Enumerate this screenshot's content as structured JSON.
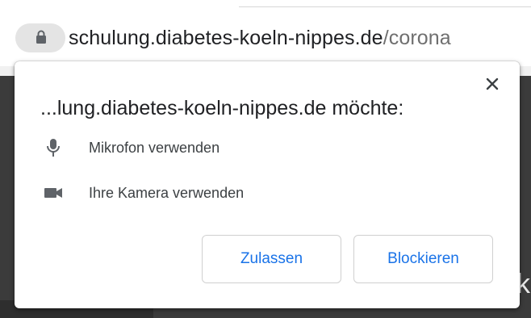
{
  "address_bar": {
    "host": "schulung.diabetes-koeln-nippes.de",
    "path": "/corona",
    "lock_icon": "lock-icon"
  },
  "page": {
    "peek_text": "k"
  },
  "permission_dialog": {
    "title": "...lung.diabetes-koeln-nippes.de möchte:",
    "close_icon": "close-icon",
    "permissions": [
      {
        "icon": "microphone-icon",
        "label": "Mikrofon verwenden"
      },
      {
        "icon": "camera-icon",
        "label": "Ihre Kamera verwenden"
      }
    ],
    "allow_label": "Zulassen",
    "block_label": "Blockieren"
  },
  "colors": {
    "accent": "#1a73e8",
    "icon": "#5f6368",
    "page_background": "#3b3b3b"
  }
}
